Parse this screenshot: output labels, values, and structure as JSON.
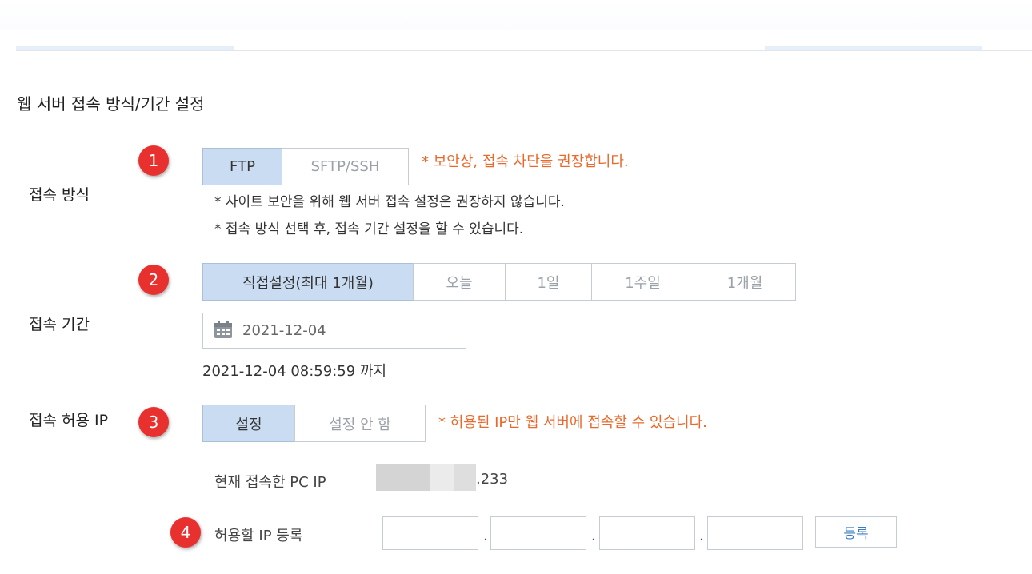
{
  "section_title": "웹 서버 접속 방식/기간 설정",
  "badges": [
    "1",
    "2",
    "3",
    "4"
  ],
  "connection_method": {
    "label": "접속 방식",
    "options": [
      {
        "label": "FTP",
        "active": true
      },
      {
        "label": "SFTP/SSH",
        "active": false
      }
    ],
    "warning": "* 보안상, 접속 차단을 권장합니다.",
    "notes": [
      "* 사이트 보안을 위해 웹 서버 접속 설정은 권장하지 않습니다.",
      "* 접속 방식 선택 후, 접속 기간 설정을 할 수 있습니다."
    ]
  },
  "connection_period": {
    "label": "접속 기간",
    "options": [
      {
        "label": "직접설정(최대 1개월)",
        "active": true
      },
      {
        "label": "오늘",
        "active": false
      },
      {
        "label": "1일",
        "active": false
      },
      {
        "label": "1주일",
        "active": false
      },
      {
        "label": "1개월",
        "active": false
      }
    ],
    "date_value": "2021-12-04",
    "until_text": "2021-12-04 08:59:59 까지"
  },
  "allowed_ip": {
    "label": "접속 허용 IP",
    "options": [
      {
        "label": "설정",
        "active": true
      },
      {
        "label": "설정 안 함",
        "active": false
      }
    ],
    "warning": "* 허용된 IP만 웹 서버에 접속할 수 있습니다.",
    "current_ip_label": "현재 접속한 PC IP",
    "current_ip_suffix": ".233",
    "register_label": "허용할 IP 등록",
    "ip_inputs": [
      "",
      "",
      "",
      ""
    ],
    "ip_separator": ".",
    "register_button": "등록"
  },
  "colors": {
    "accent_active": "#c9dcf2",
    "warning": "#e8692c",
    "badge": "#e8302e",
    "button_text": "#3a7bc4"
  },
  "icons": {
    "date": "calendar-icon"
  }
}
